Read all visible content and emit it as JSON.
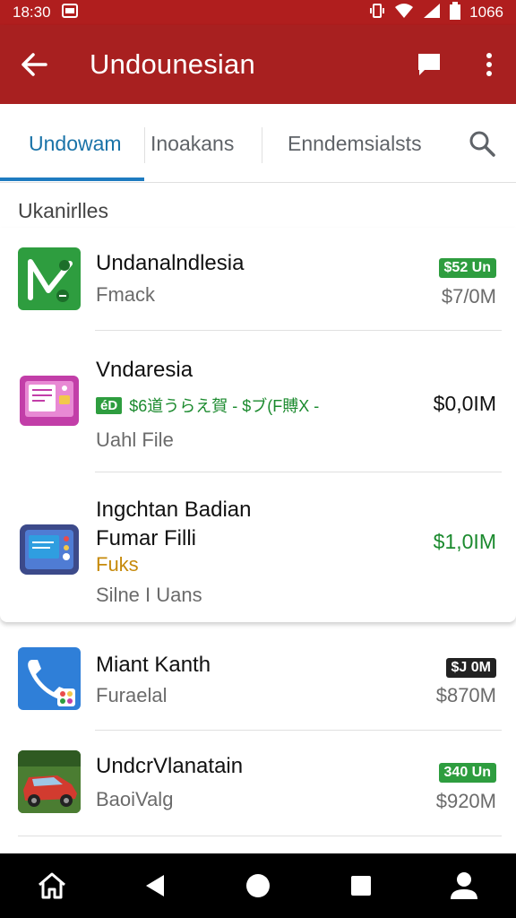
{
  "status_bar": {
    "time": "18:30",
    "battery": "1066"
  },
  "app_bar": {
    "title": "Undounesian"
  },
  "tabs": [
    {
      "label": "Undowam",
      "active": true
    },
    {
      "label": "Inoakans",
      "active": false
    },
    {
      "label": "Enndemsialsts",
      "active": false
    }
  ],
  "section_label": "Ukanirlles",
  "apps": [
    {
      "title": "Undanalndlesia",
      "subtitle": "Fmack",
      "badge": "$52 Un",
      "price": "$7/0M",
      "icon": "green-map-icon"
    },
    {
      "title": "Vndaresia",
      "promo_chip": "éD",
      "promo_text": "$6道うらえ賀 - $ブ(F賻X -",
      "subtitle": "Uahl File",
      "price": "$0,0IM",
      "icon": "pink-device-icon"
    },
    {
      "title_line1": "Ingchtan Badian",
      "title_line2": "Fumar Filli",
      "orange_label": "Fuks",
      "subtitle": "Silne I Uans",
      "price": "$1,0IM",
      "icon": "blue-device-icon"
    },
    {
      "title": "Miant Kanth",
      "subtitle": "Furaelal",
      "badge": "$J 0M",
      "price": "$870M",
      "icon": "phone-app-icon"
    },
    {
      "title": "UndcrVlanatain",
      "subtitle": "BaoiValg",
      "badge": "340 Un",
      "price": "$920M",
      "icon": "car-photo-icon"
    }
  ],
  "colors": {
    "app_bar": "#a82020",
    "status_bar": "#b01e1e",
    "tab_accent": "#1e7bc0",
    "green": "#2e9d3f"
  }
}
